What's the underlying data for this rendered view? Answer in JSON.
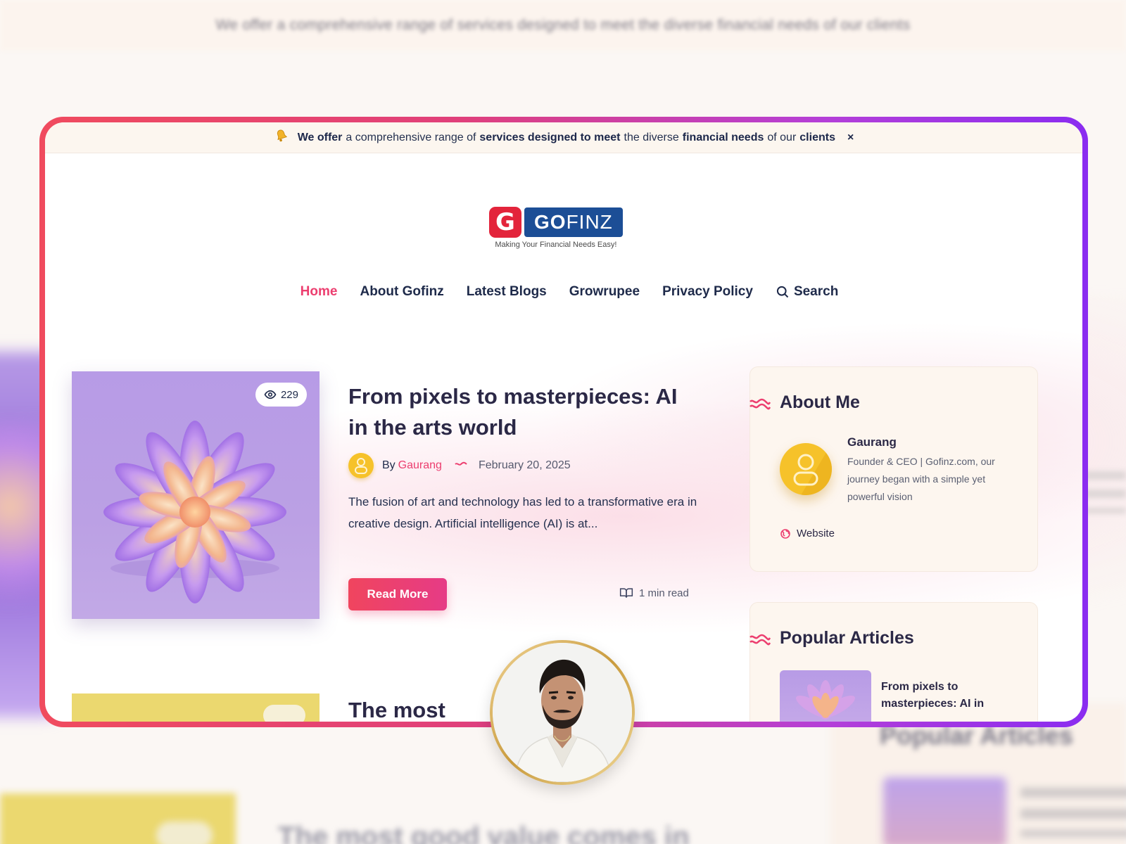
{
  "background": {
    "announce_text": "We offer a comprehensive range of services designed to meet the diverse financial needs of our clients",
    "popular_title": "Popular Articles",
    "next_title": "The most good value comes in"
  },
  "announce": {
    "icon": "bell-icon",
    "segments": [
      {
        "text": "We offer",
        "bold": true
      },
      {
        "text": "a comprehensive range of",
        "bold": false
      },
      {
        "text": "services designed to meet",
        "bold": true
      },
      {
        "text": "the diverse",
        "bold": false
      },
      {
        "text": "financial needs",
        "bold": true
      },
      {
        "text": "of our",
        "bold": false
      },
      {
        "text": "clients",
        "bold": true
      }
    ],
    "close_label": "×"
  },
  "logo": {
    "mark": "G",
    "word_bold": "GO",
    "word_light": "FINZ",
    "tagline": "Making Your Financial Needs Easy!"
  },
  "nav": {
    "items": [
      {
        "label": "Home",
        "active": true
      },
      {
        "label": "About Gofinz",
        "active": false
      },
      {
        "label": "Latest Blogs",
        "active": false
      },
      {
        "label": "Growrupee",
        "active": false
      },
      {
        "label": "Privacy Policy",
        "active": false
      }
    ],
    "search_label": "Search"
  },
  "post": {
    "views": "229",
    "title": "From pixels to masterpieces: AI in the arts world",
    "by_label": "By",
    "author": "Gaurang",
    "date": "February 20, 2025",
    "excerpt": "The fusion of art and technology has led to a transformative era in creative design. Artificial intelligence (AI) is at...",
    "read_more": "Read More",
    "read_time": "1 min read"
  },
  "next_post": {
    "title": "The most"
  },
  "sidebar": {
    "about": {
      "heading": "About Me",
      "name": "Gaurang",
      "bio": "Founder & CEO | Gofinz.com, our journey began with a simple yet powerful vision",
      "website_label": "Website"
    },
    "popular": {
      "heading": "Popular Articles",
      "items": [
        {
          "title": "From pixels to masterpieces: AI in"
        }
      ]
    }
  },
  "colors": {
    "accent": "#ec3e6f",
    "navy": "#1e2a4a",
    "frame_start": "#f04b5e",
    "frame_end": "#8a2cf0",
    "logo_blue": "#1c4e96",
    "logo_red": "#e3243b"
  }
}
